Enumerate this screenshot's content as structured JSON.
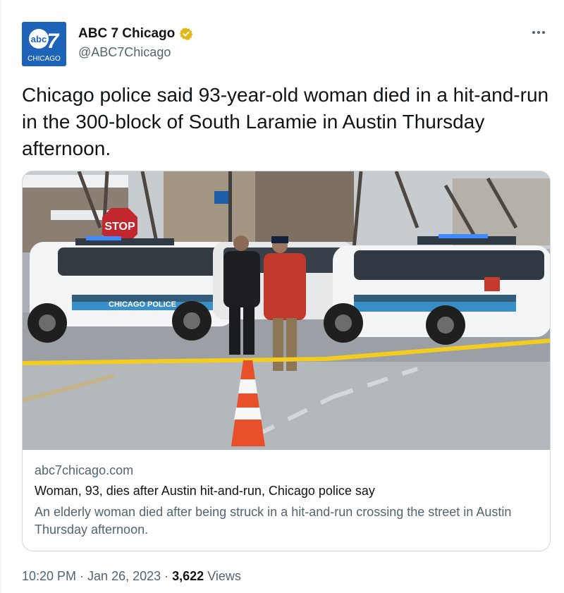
{
  "author": {
    "name": "ABC 7 Chicago",
    "handle": "@ABC7Chicago",
    "avatar_text": "abc7",
    "avatar_sub": "CHICAGO",
    "verified_color": "#e2b719"
  },
  "tweet": {
    "text": "Chicago police said 93-year-old woman died in a hit-and-run in the 300-block of South Laramie in Austin Thursday afternoon."
  },
  "card": {
    "image_sign_text": "STOP",
    "image_car_text": "CHICAGO POLICE",
    "domain": "abc7chicago.com",
    "title": "Woman, 93, dies after Austin hit-and-run, Chicago police say",
    "description": "An elderly woman died after being struck in a hit-and-run crossing the street in Austin Thursday afternoon."
  },
  "meta": {
    "time": "10:20 PM",
    "separator": "·",
    "date": "Jan 26, 2023",
    "views_count": "3,622",
    "views_label": "Views"
  },
  "icons": [
    "more-icon",
    "verified-badge-icon",
    "abc7-logo-icon"
  ],
  "colors": {
    "text_primary": "#0f1419",
    "text_secondary": "#536471",
    "border": "#cfd9de",
    "brand_blue": "#1d63b8"
  }
}
